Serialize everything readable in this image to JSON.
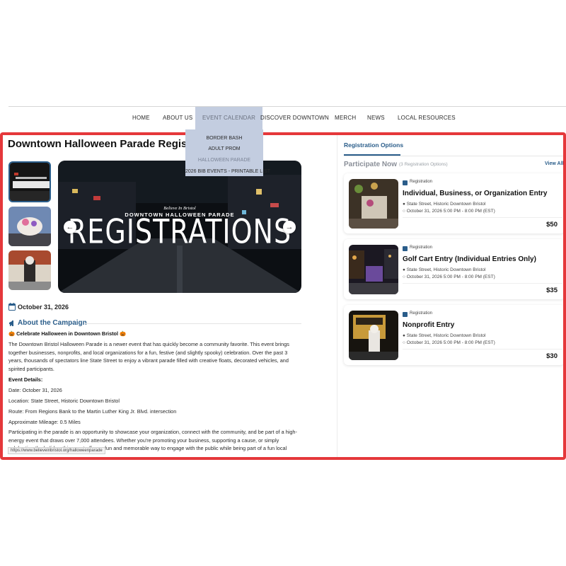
{
  "nav": {
    "items": [
      "HOME",
      "ABOUT US",
      "EVENT CALENDAR",
      "DISCOVER DOWNTOWN",
      "MERCH",
      "NEWS",
      "LOCAL RESOURCES"
    ],
    "dropdown": [
      "BORDER BASH",
      "ADULT PROM",
      "HALLOWEEN PARADE",
      "2026 BIB EVENTS - PRINTABLE LIST"
    ]
  },
  "campaign": {
    "title": "Downtown Halloween Parade Registration",
    "hero": {
      "script_text": "Believe In Bristol",
      "subtitle": "DOWNTOWN HALLOWEEN PARADE",
      "headline": "REGISTRATIONS"
    },
    "date": "October 31, 2026",
    "about_heading": "About the Campaign",
    "intro_heading": "🎃 Celebrate Halloween in Downtown Bristol 🎃",
    "intro": "The Downtown Bristol Halloween Parade is a newer event that has quickly become a community favorite. This event brings together businesses, nonprofits, and local organizations for a fun, festive (and slightly spooky) celebration. Over the past 3 years, thousands of spectators line State Street to enjoy a vibrant parade filled with creative floats, decorated vehicles, and spirited participants.",
    "details_heading": "Event Details:",
    "details": [
      "Date: October 31, 2026",
      "Location: State Street, Historic Downtown Bristol",
      "Route: From Regions Bank to the Martin Luther King Jr. Blvd. intersection",
      "Approximate Mileage: 0.5 Miles"
    ],
    "closing": "Participating in the parade is an opportunity to showcase your organization, connect with the community, and be part of a high-energy event that draws over 7,000 attendees. Whether you're promoting your business, supporting a cause, or simply celebrating the holiday, this event offers a fun and memorable way to engage with the public while being part of a fun local",
    "status_url": "https://www.believeinbristol.org/halloweenparade"
  },
  "registration": {
    "tab_label": "Registration Options",
    "section_title": "Participate Now",
    "count_label": "(3 Registration Options)",
    "view_all": "View All",
    "badge": "Registration",
    "cards": [
      {
        "title": "Individual, Business, or Organization Entry",
        "location": "State Street, Historic Downtown Bristol",
        "time": "October 31, 2026 5:00 PM - 8:00 PM (EST)",
        "price": "$50"
      },
      {
        "title": "Golf Cart Entry (Individual Entries Only)",
        "location": "State Street, Historic Downtown Bristol",
        "time": "October 31, 2026 5:00 PM - 8:00 PM (EST)",
        "price": "$35"
      },
      {
        "title": "Nonprofit Entry",
        "location": "State Street, Historic Downtown Bristol",
        "time": "October 31, 2026 5:00 PM - 8:00 PM (EST)",
        "price": "$30"
      }
    ]
  },
  "colors": {
    "accent": "#2a5d8a",
    "frame": "#e5383b",
    "dropdown_bg": "#c3cde0"
  },
  "icons": [
    "calendar-icon",
    "megaphone-icon",
    "chevron-left-icon",
    "chevron-right-icon",
    "location-pin-icon",
    "clock-icon"
  ]
}
